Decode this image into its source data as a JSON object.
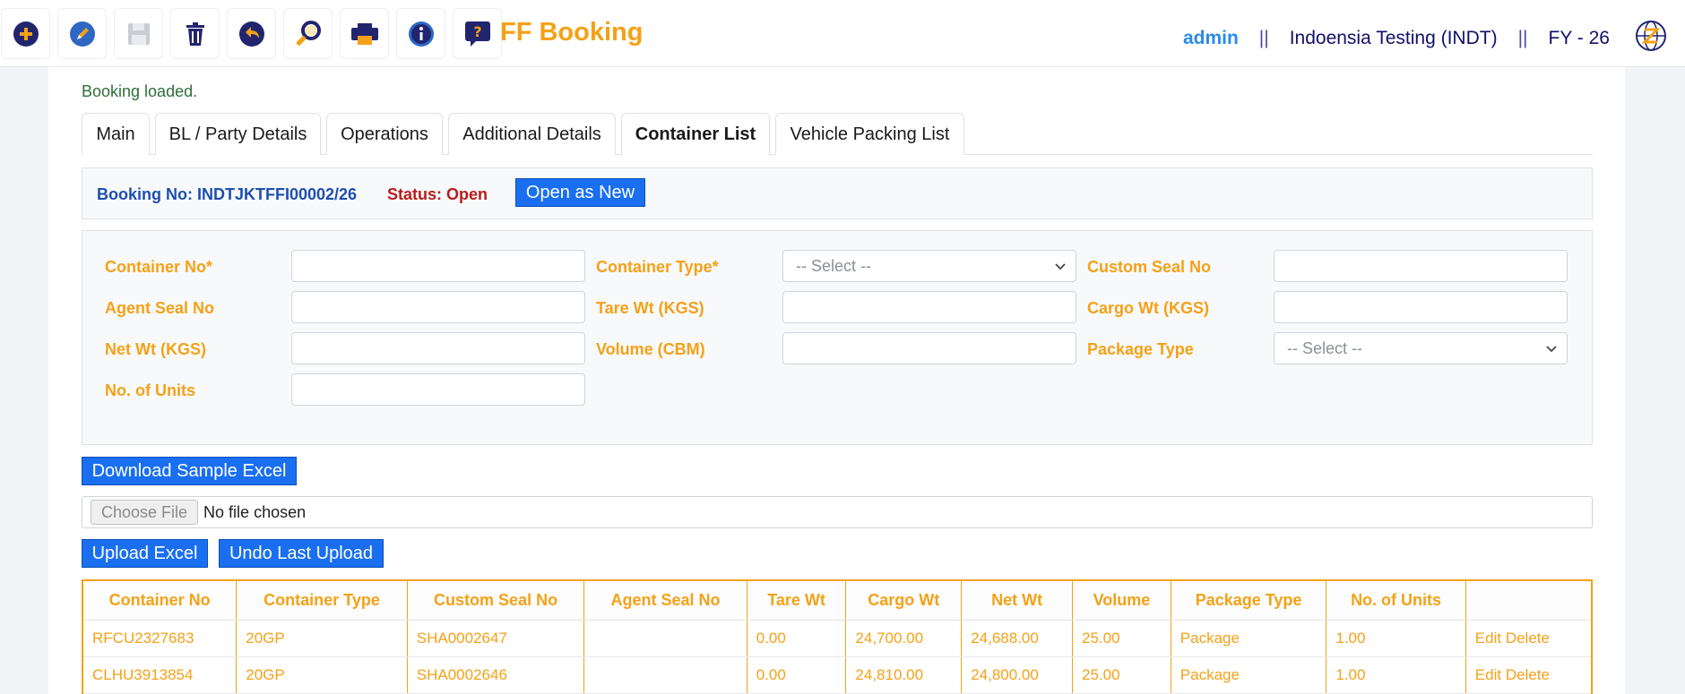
{
  "app": {
    "title": "FF Booking"
  },
  "toolbar": {
    "icons": [
      "add-icon",
      "edit-icon",
      "save-icon",
      "delete-icon",
      "undo-icon",
      "search-icon",
      "print-icon",
      "info-icon",
      "help-icon"
    ]
  },
  "header": {
    "user": "admin",
    "separator": "||",
    "company": "Indoensia Testing (INDT)",
    "fy": "FY - 26"
  },
  "status_message": "Booking loaded.",
  "tabs": [
    {
      "label": "Main"
    },
    {
      "label": "BL / Party Details"
    },
    {
      "label": "Operations"
    },
    {
      "label": "Additional Details"
    },
    {
      "label": "Container List",
      "active": true
    },
    {
      "label": "Vehicle Packing List"
    }
  ],
  "booking": {
    "number_text": "Booking No: INDTJKTFFI00002/26",
    "status_text": "Status: Open",
    "open_as_new_label": "Open as New"
  },
  "form": {
    "container_no": {
      "label": "Container No*",
      "value": ""
    },
    "container_type": {
      "label": "Container Type*",
      "selected": "-- Select --"
    },
    "custom_seal_no": {
      "label": "Custom Seal No",
      "value": ""
    },
    "agent_seal_no": {
      "label": "Agent Seal No",
      "value": ""
    },
    "tare_wt": {
      "label": "Tare Wt (KGS)",
      "value": ""
    },
    "cargo_wt": {
      "label": "Cargo Wt (KGS)",
      "value": ""
    },
    "net_wt": {
      "label": "Net Wt (KGS)",
      "value": ""
    },
    "volume": {
      "label": "Volume (CBM)",
      "value": ""
    },
    "package_type": {
      "label": "Package Type",
      "selected": "-- Select --"
    },
    "no_of_units": {
      "label": "No. of Units",
      "value": ""
    }
  },
  "excel": {
    "download_label": "Download Sample Excel",
    "choose_file_label": "Choose File",
    "no_file_text": "No file chosen",
    "upload_label": "Upload Excel",
    "undo_label": "Undo Last Upload"
  },
  "grid": {
    "columns": [
      "Container No",
      "Container Type",
      "Custom Seal No",
      "Agent Seal No",
      "Tare Wt",
      "Cargo Wt",
      "Net Wt",
      "Volume",
      "Package Type",
      "No. of Units",
      ""
    ],
    "rows": [
      [
        "RFCU2327683",
        "20GP",
        "SHA0002647",
        "",
        "0.00",
        "24,700.00",
        "24,688.00",
        "25.00",
        "Package",
        "1.00"
      ],
      [
        "CLHU3913854",
        "20GP",
        "SHA0002646",
        "",
        "0.00",
        "24,810.00",
        "24,800.00",
        "25.00",
        "Package",
        "1.00"
      ]
    ],
    "edit_label": "Edit",
    "delete_label": "Delete"
  },
  "colors": {
    "accent_orange": "#f4a117",
    "primary_blue": "#1a6ff0",
    "navy": "#10106a",
    "status_red": "#b91c1c"
  }
}
